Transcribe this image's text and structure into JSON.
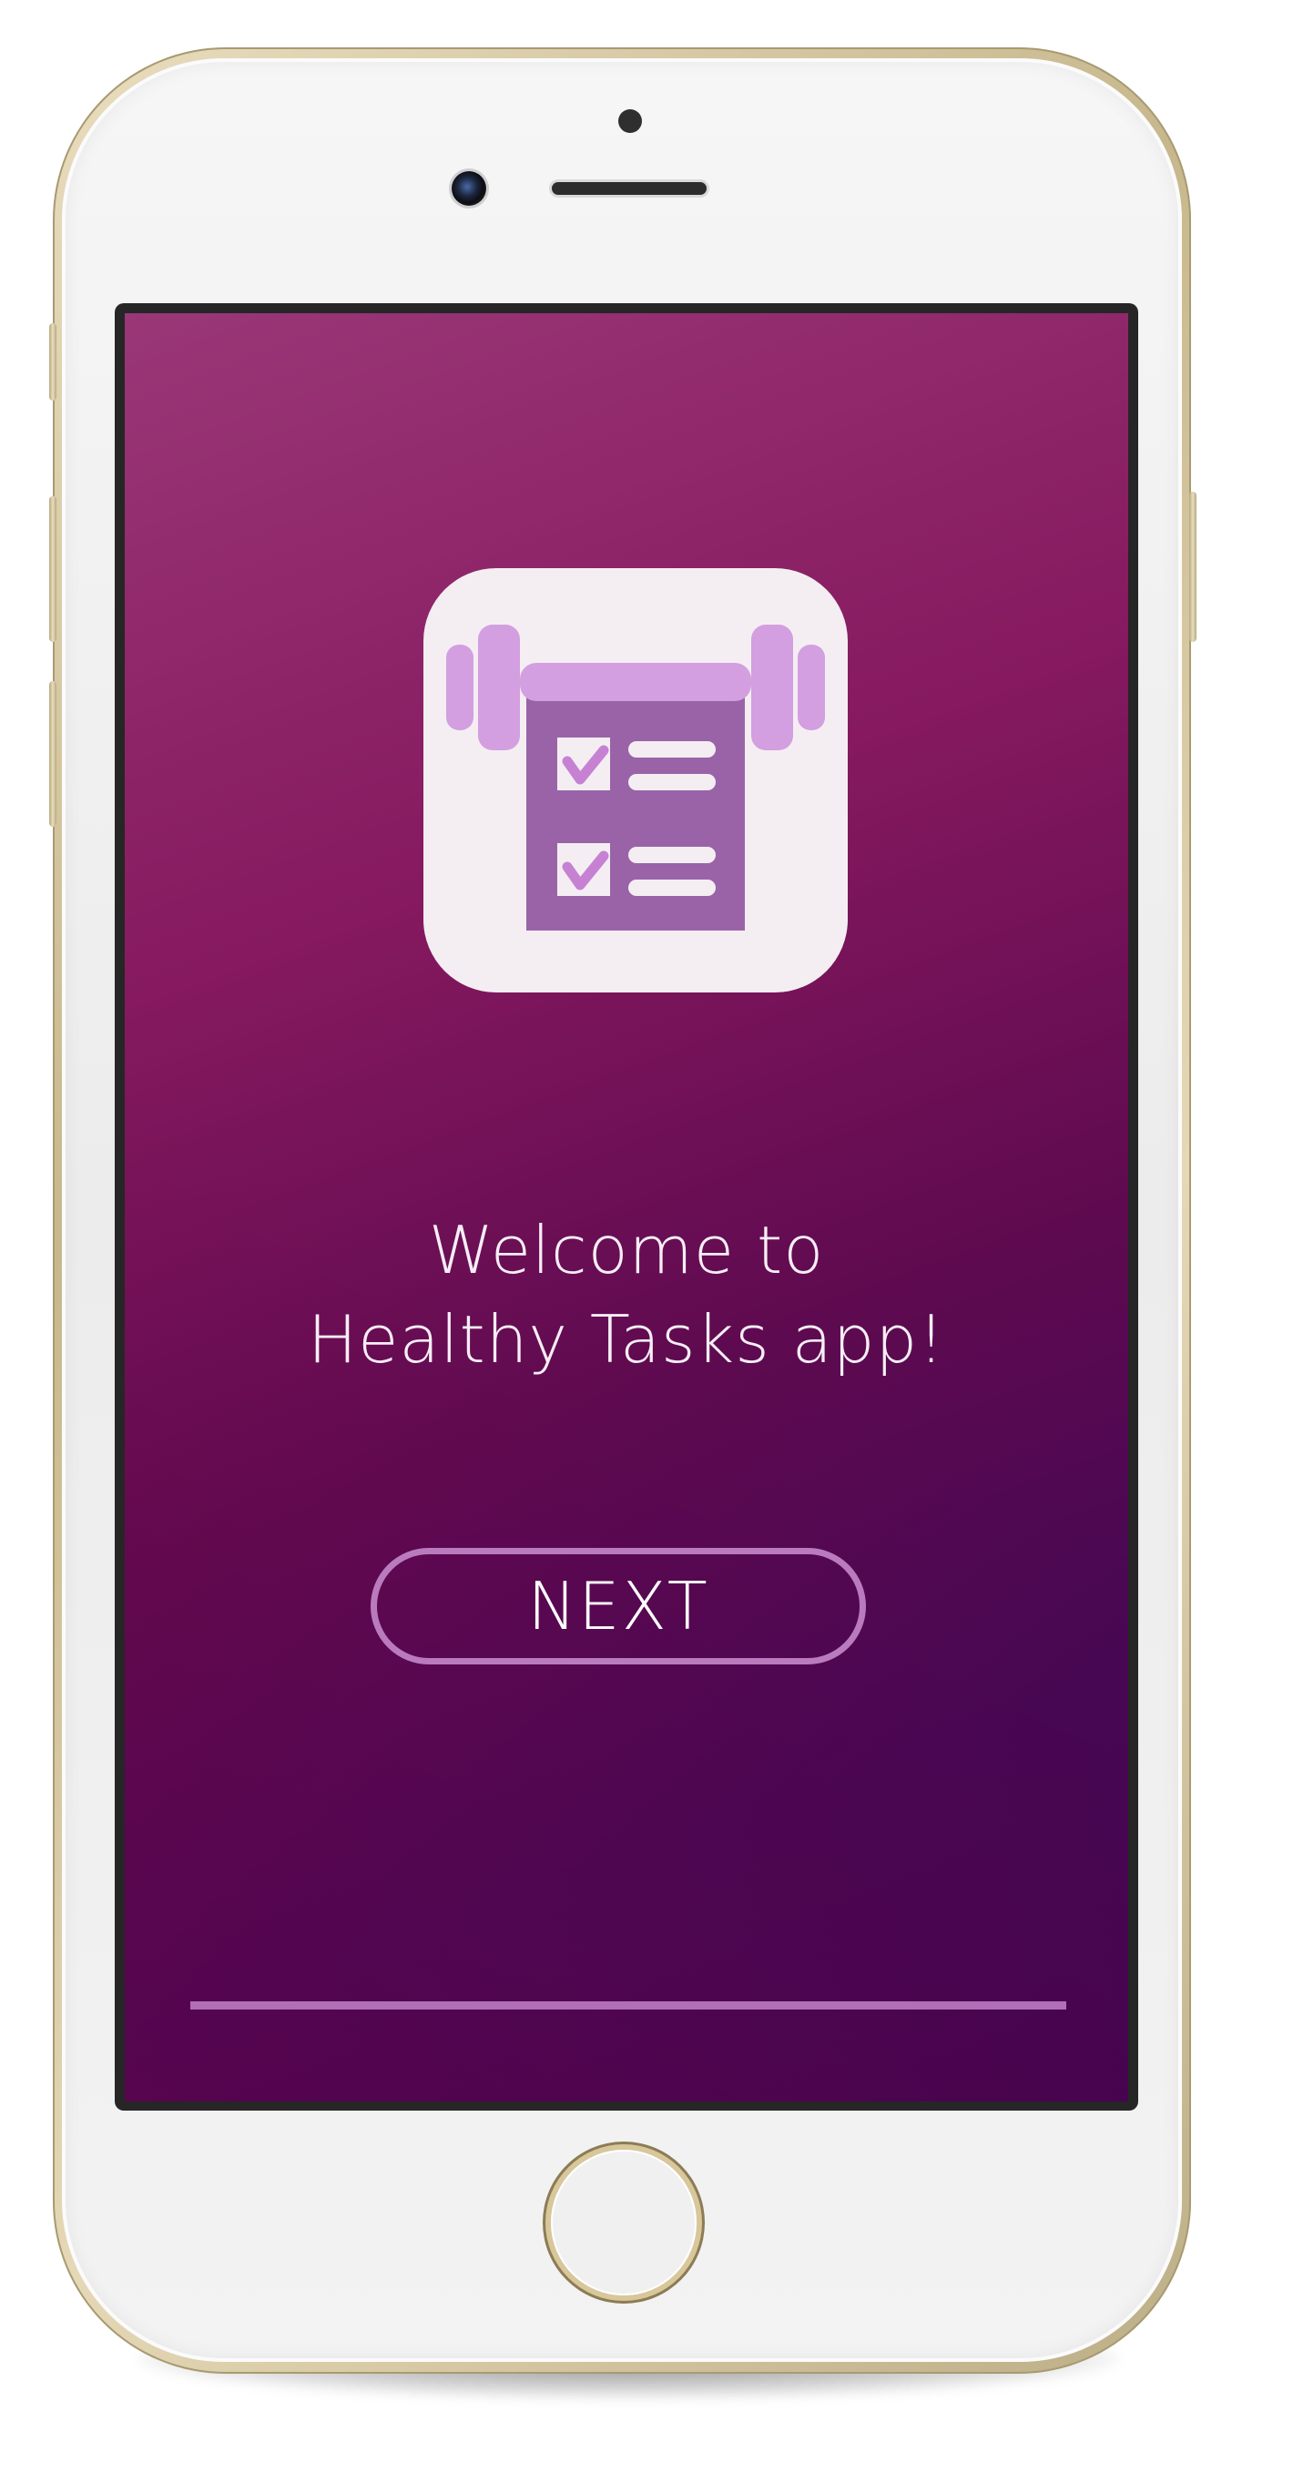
{
  "app": {
    "name": "Healthy Tasks",
    "welcome_line1": "Welcome to",
    "welcome_line2": "Healthy Tasks app!",
    "next_label": "NEXT"
  },
  "device": {
    "model": "iPhone",
    "color": "gold"
  },
  "icons": {
    "app_icon": "checklist-dumbbell-icon",
    "camera": "front-camera-icon",
    "home": "home-button-icon"
  },
  "colors": {
    "gradient_top_left": "#9a3777",
    "gradient_bottom_right": "#3c0550",
    "button_border": "#b97bbd",
    "icon_accent": "#d39fe0",
    "icon_clipboard": "#9a63a8",
    "progress_line": "#b06fb6"
  }
}
